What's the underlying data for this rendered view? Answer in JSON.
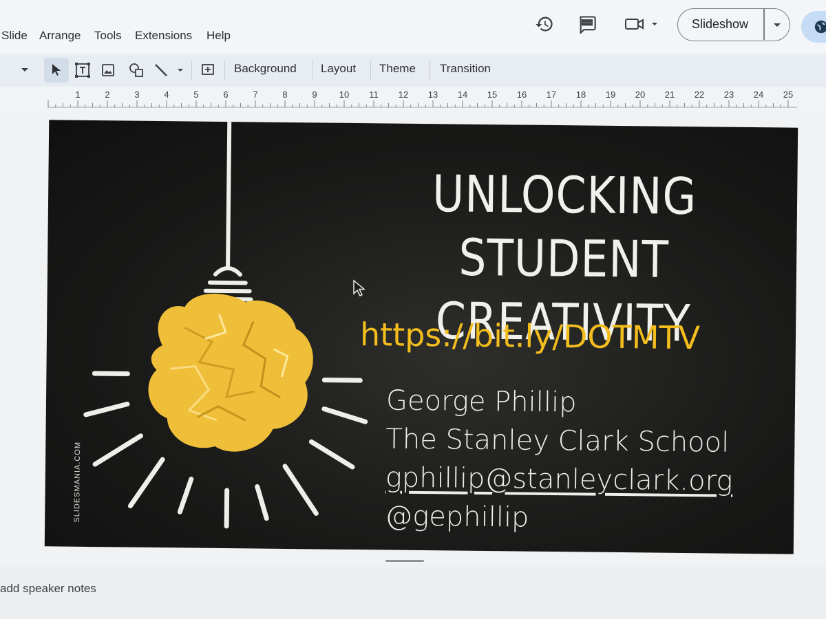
{
  "menu": {
    "items": [
      "Slide",
      "Arrange",
      "Tools",
      "Extensions",
      "Help"
    ]
  },
  "header": {
    "slideshow_label": "Slideshow"
  },
  "icons": {
    "history": "history-icon",
    "comments": "comments-icon",
    "meet": "video-camera-icon",
    "share": "globe-icon"
  },
  "toolbar": {
    "background_label": "Background",
    "layout_label": "Layout",
    "theme_label": "Theme",
    "transition_label": "Transition"
  },
  "ruler": {
    "marks": [
      "1",
      "2",
      "3",
      "4",
      "5",
      "6",
      "7",
      "8",
      "9",
      "10",
      "11",
      "12",
      "13",
      "14",
      "15",
      "16",
      "17",
      "18",
      "19",
      "20",
      "21",
      "22",
      "23",
      "24",
      "25"
    ]
  },
  "slide": {
    "title_line1": "UNLOCKING STUDENT",
    "title_line2": "CREATIVITY",
    "link": "https://bit.ly/DOTMTV",
    "name": "George Phillip",
    "school": "The Stanley Clark School",
    "email": "gphillip@stanleyclark.org",
    "handle": "@gephillip",
    "watermark": "SLIDESMANIA.COM"
  },
  "notes": {
    "placeholder": "add speaker notes"
  },
  "colors": {
    "slide_bg": "#161615",
    "title_text": "#f1f1ec",
    "link_text": "#f2bd1d",
    "paper_bulb": "#efbf3a"
  }
}
